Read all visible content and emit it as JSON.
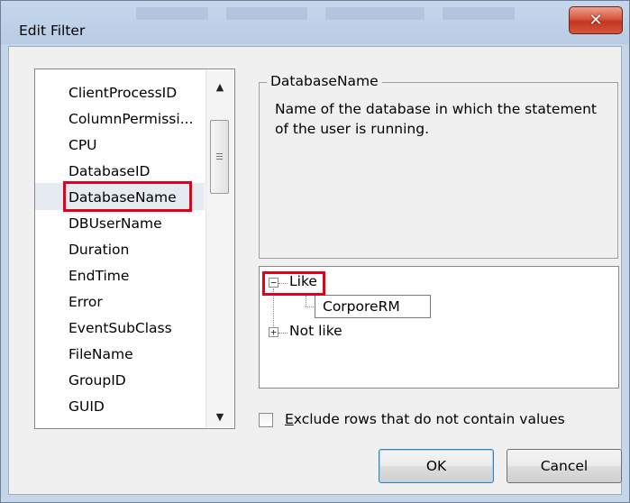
{
  "window": {
    "title": "Edit Filter",
    "close_glyph": "✕"
  },
  "columns": {
    "items": [
      "ClientProcessID",
      "ColumnPermissi...",
      "CPU",
      "DatabaseID",
      "DatabaseName",
      "DBUserName",
      "Duration",
      "EndTime",
      "Error",
      "EventSubClass",
      "FileName",
      "GroupID",
      "GUID"
    ],
    "selected": "DatabaseName"
  },
  "description": {
    "title": "DatabaseName",
    "text": "Name of the database in which the statement of the user is running."
  },
  "criteria": {
    "like_label": "Like",
    "like_expander": "−",
    "like_value": "CorporeRM",
    "not_like_label": "Not like",
    "not_like_expander": "+"
  },
  "options": {
    "exclude_accesskey": "E",
    "exclude_label_rest": "xclude rows that do not contain values",
    "exclude_checked": false
  },
  "buttons": {
    "ok": "OK",
    "cancel": "Cancel"
  },
  "colors": {
    "highlight": "#e3001b",
    "close_button": "#c2361f",
    "selection": "#e6eaf1"
  }
}
